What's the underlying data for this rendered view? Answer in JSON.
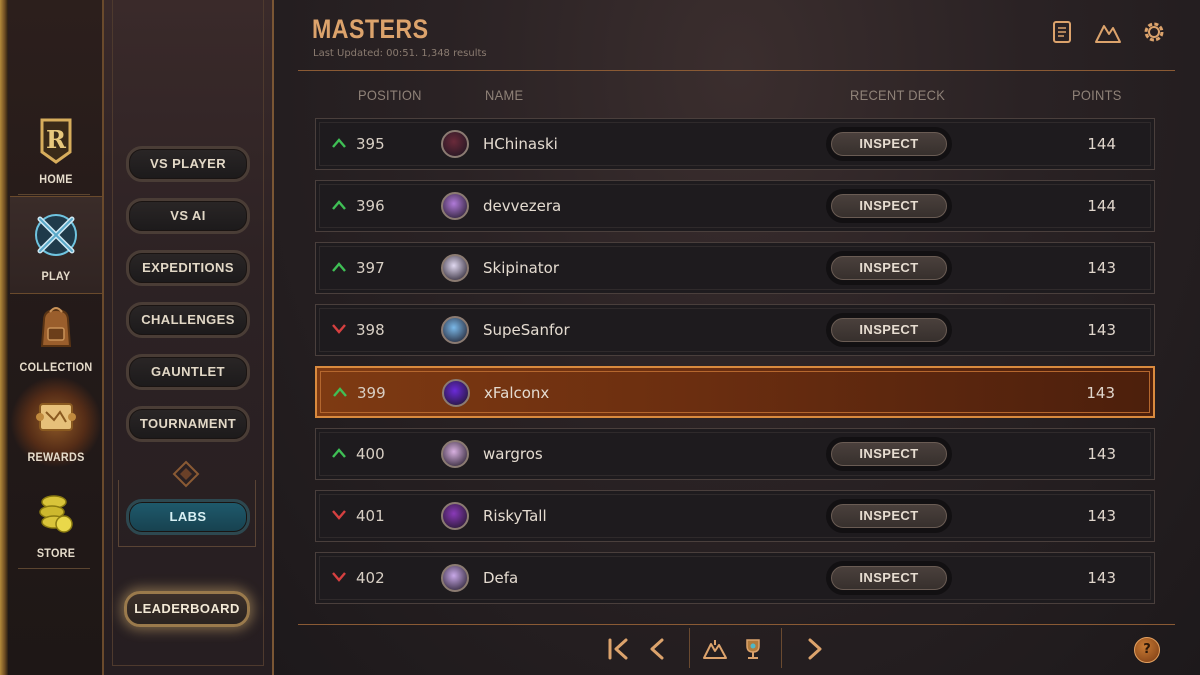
{
  "nav": {
    "items": [
      {
        "label": "HOME",
        "icon": "runeterra-logo-icon"
      },
      {
        "label": "PLAY",
        "icon": "crossed-swords-icon"
      },
      {
        "label": "COLLECTION",
        "icon": "backpack-icon"
      },
      {
        "label": "REWARDS",
        "icon": "scroll-map-icon"
      },
      {
        "label": "STORE",
        "icon": "coins-icon"
      }
    ]
  },
  "play_menu": {
    "vs_player": "VS PLAYER",
    "vs_ai": "VS AI",
    "expeditions": "EXPEDITIONS",
    "challenges": "CHALLENGES",
    "gauntlet": "GAUNTLET",
    "tournament": "TOURNAMENT",
    "labs": "LABS",
    "leaderboard": "LEADERBOARD"
  },
  "header": {
    "title": "MASTERS",
    "subtitle": "Last Updated: 00:51. 1,348 results"
  },
  "columns": {
    "position": "POSITION",
    "name": "NAME",
    "deck": "RECENT DECK",
    "points": "POINTS"
  },
  "inspect_label": "INSPECT",
  "rows": [
    {
      "trend": "up",
      "position": "395",
      "name": "HChinaski",
      "points": "144"
    },
    {
      "trend": "up",
      "position": "396",
      "name": "devvezera",
      "points": "144"
    },
    {
      "trend": "up",
      "position": "397",
      "name": "Skipinator",
      "points": "143"
    },
    {
      "trend": "down",
      "position": "398",
      "name": "SupeSanfor",
      "points": "143"
    },
    {
      "trend": "up",
      "position": "399",
      "name": "xFalconx",
      "points": "143",
      "highlight": true
    },
    {
      "trend": "up",
      "position": "400",
      "name": "wargros",
      "points": "143"
    },
    {
      "trend": "down",
      "position": "401",
      "name": "RiskyTall",
      "points": "143"
    },
    {
      "trend": "down",
      "position": "402",
      "name": "Defa",
      "points": "143"
    }
  ],
  "help_label": "?",
  "colors": {
    "accent": "#dca36c",
    "highlight_row": "#7e3a12",
    "trend_up": "#3fbf55",
    "trend_down": "#d64040",
    "labs": "#1f5a6c"
  }
}
